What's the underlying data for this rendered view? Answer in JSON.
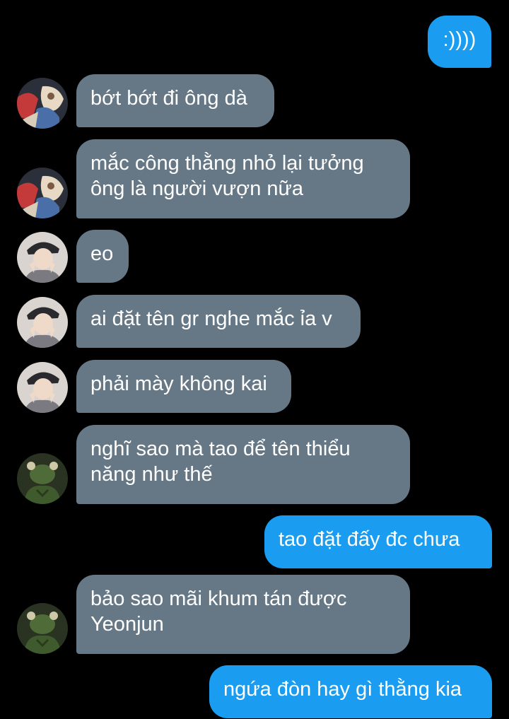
{
  "messages": [
    {
      "side": "out",
      "text": ":))))"
    },
    {
      "side": "in",
      "sender": "anime-avatar",
      "text": "bớt bớt đi ông dà"
    },
    {
      "side": "in",
      "sender": "anime-avatar",
      "text": "mắc công thằng nhỏ lại tưởng\nông là người vượn nữa"
    },
    {
      "side": "in",
      "sender": "cap-avatar",
      "text": "eo"
    },
    {
      "side": "in",
      "sender": "cap-avatar",
      "text": "ai đặt tên gr nghe mắc ỉa v"
    },
    {
      "side": "in",
      "sender": "cap-avatar",
      "text": "phải mày không kai"
    },
    {
      "side": "in",
      "sender": "green-avatar",
      "text": "nghĩ sao mà tao để tên thiểu\nnăng như thế"
    },
    {
      "side": "out",
      "text": "tao đặt đấy đc chưa"
    },
    {
      "side": "in",
      "sender": "green-avatar",
      "text": "bảo sao mãi khum tán được\nYeonjun"
    },
    {
      "side": "out",
      "text": "ngứa đòn hay gì thằng kia"
    }
  ],
  "colors": {
    "background": "#000000",
    "incoming_bubble": "#667785",
    "outgoing_bubble": "#1a9df0",
    "text": "#ffffff"
  }
}
